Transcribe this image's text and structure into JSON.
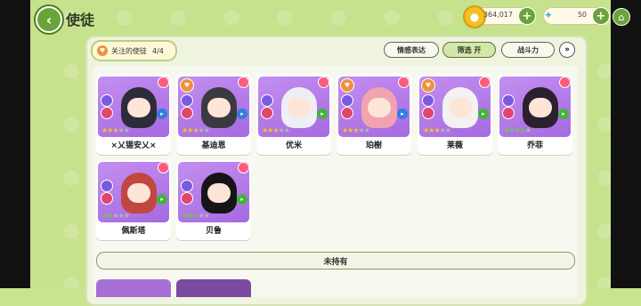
{
  "header": {
    "title": "使徒",
    "coins": "364,017",
    "gems": "50"
  },
  "filter": {
    "favorite_label": "关注的使徒",
    "favorite_count": "4/4",
    "btn_emotion": "情感表达",
    "btn_filter": "筛选 开",
    "btn_power": "战斗力"
  },
  "cards": [
    {
      "name": "×乂锡安乂×",
      "stars": "on3",
      "fav": false,
      "hair": "#2c2c3a"
    },
    {
      "name": "基迪恩",
      "stars": "on3",
      "fav": true,
      "hair": "#3a3a40"
    },
    {
      "name": "优米",
      "stars": "on3",
      "fav": false,
      "hair": "#eeeef5"
    },
    {
      "name": "珀榭",
      "stars": "on3",
      "fav": true,
      "hair": "#f1a3b0"
    },
    {
      "name": "莱薇",
      "stars": "on3",
      "fav": true,
      "hair": "#f2f2f2"
    },
    {
      "name": "乔菲",
      "stars": "g4",
      "fav": false,
      "hair": "#2a2030"
    },
    {
      "name": "佩斯塔",
      "stars": "g2",
      "fav": false,
      "hair": "#c2473f"
    },
    {
      "name": "贝鲁",
      "stars": "g3",
      "fav": false,
      "hair": "#151518"
    }
  ],
  "not_owned_label": "未持有"
}
